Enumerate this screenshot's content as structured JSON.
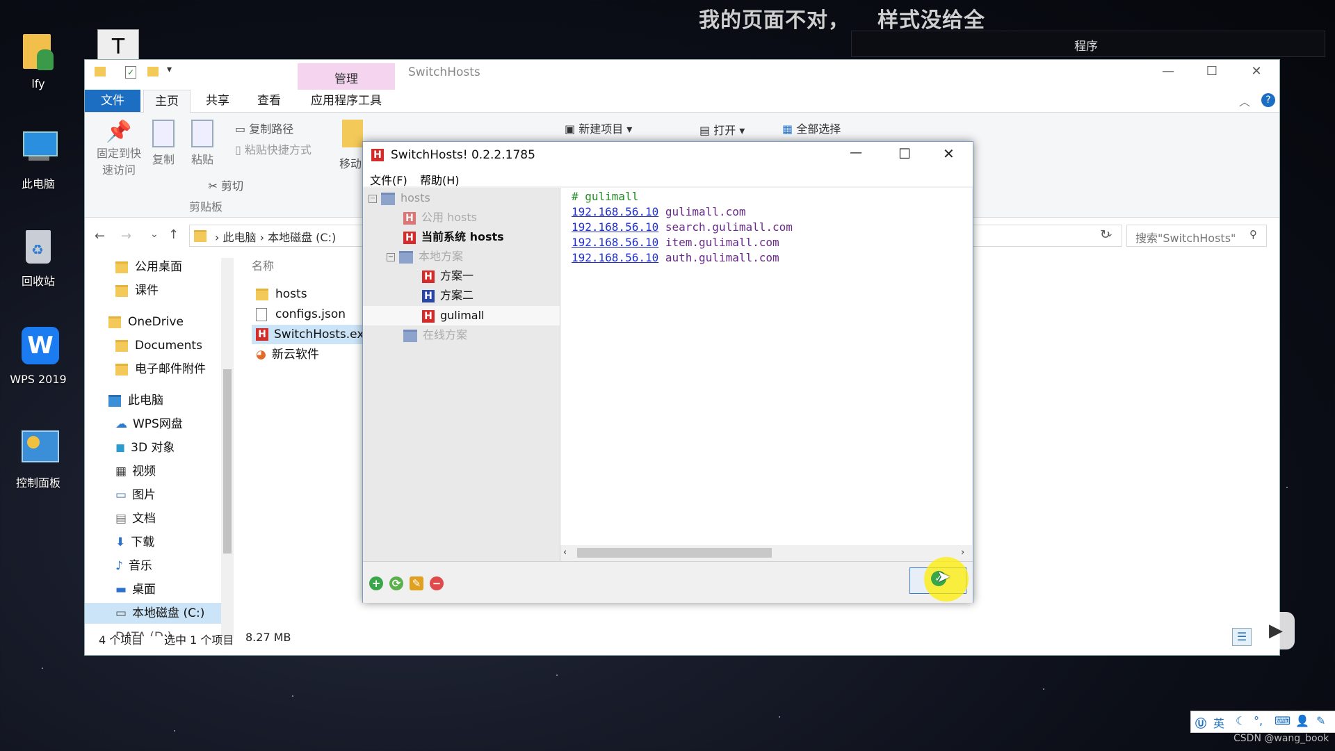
{
  "caption": {
    "part1": "我的页面不对，",
    "part2": "样式没给全"
  },
  "bg_window": {
    "title": "程序"
  },
  "desktop": {
    "icons": [
      {
        "name": "user-folder-icon",
        "label": "lfy"
      },
      {
        "name": "this-pc-icon",
        "label": "此电脑"
      },
      {
        "name": "recycle-bin-icon",
        "label": "回收站"
      },
      {
        "name": "wps-icon",
        "label": "WPS 2019"
      },
      {
        "name": "control-panel-icon",
        "label": "控制面板"
      }
    ]
  },
  "explorer": {
    "title": "SwitchHosts",
    "context_tab": "管理",
    "tabs": {
      "file": "文件",
      "home": "主页",
      "share": "共享",
      "view": "查看",
      "app_tools": "应用程序工具"
    },
    "ribbon": {
      "pin_line1": "固定到快",
      "pin_line2": "速访问",
      "copy": "复制",
      "paste": "粘贴",
      "copy_path": "复制路径",
      "paste_shortcut": "粘贴快捷方式",
      "cut": "剪切",
      "clipboard_group": "剪贴板",
      "move": "移动",
      "new_item": "新建项目",
      "open": "打开",
      "select_all": "全部选择"
    },
    "breadcrumb": {
      "pc": "此电脑",
      "drive": "本地磁盘 (C:)"
    },
    "search_placeholder": "搜索\"SwitchHosts\"",
    "nav": [
      "公用桌面",
      "课件",
      "OneDrive",
      "Documents",
      "电子邮件附件",
      "此电脑",
      "WPS网盘",
      "3D 对象",
      "视频",
      "图片",
      "文档",
      "下载",
      "音乐",
      "桌面",
      "本地磁盘 (C:)",
      "DATA (D:)"
    ],
    "column_name": "名称",
    "files": [
      "hosts",
      "configs.json",
      "SwitchHosts.exe",
      "新云软件"
    ],
    "status": {
      "count": "4 个项目",
      "selected": "选中 1 个项目",
      "size": "8.27 MB"
    }
  },
  "switchhosts": {
    "title": "SwitchHosts! 0.2.2.1785",
    "menu": {
      "file": "文件(F)",
      "help": "帮助(H)"
    },
    "tree": {
      "root": "hosts",
      "public": "公用 hosts",
      "current": "当前系统 hosts",
      "local": "本地方案",
      "items": [
        "方案一",
        "方案二",
        "gulimall"
      ],
      "online": "在线方案"
    },
    "editor": {
      "comment": "# gulimall",
      "lines": [
        {
          "ip": "192.168.56.10",
          "host": "gulimall.com"
        },
        {
          "ip": "192.168.56.10",
          "host": "search.gulimall.com"
        },
        {
          "ip": "192.168.56.10",
          "host": "item.gulimall.com"
        },
        {
          "ip": "192.168.56.10",
          "host": "auth.gulimall.com"
        }
      ]
    }
  },
  "tray": {
    "ime": "英"
  },
  "watermark": "CSDN @wang_book"
}
